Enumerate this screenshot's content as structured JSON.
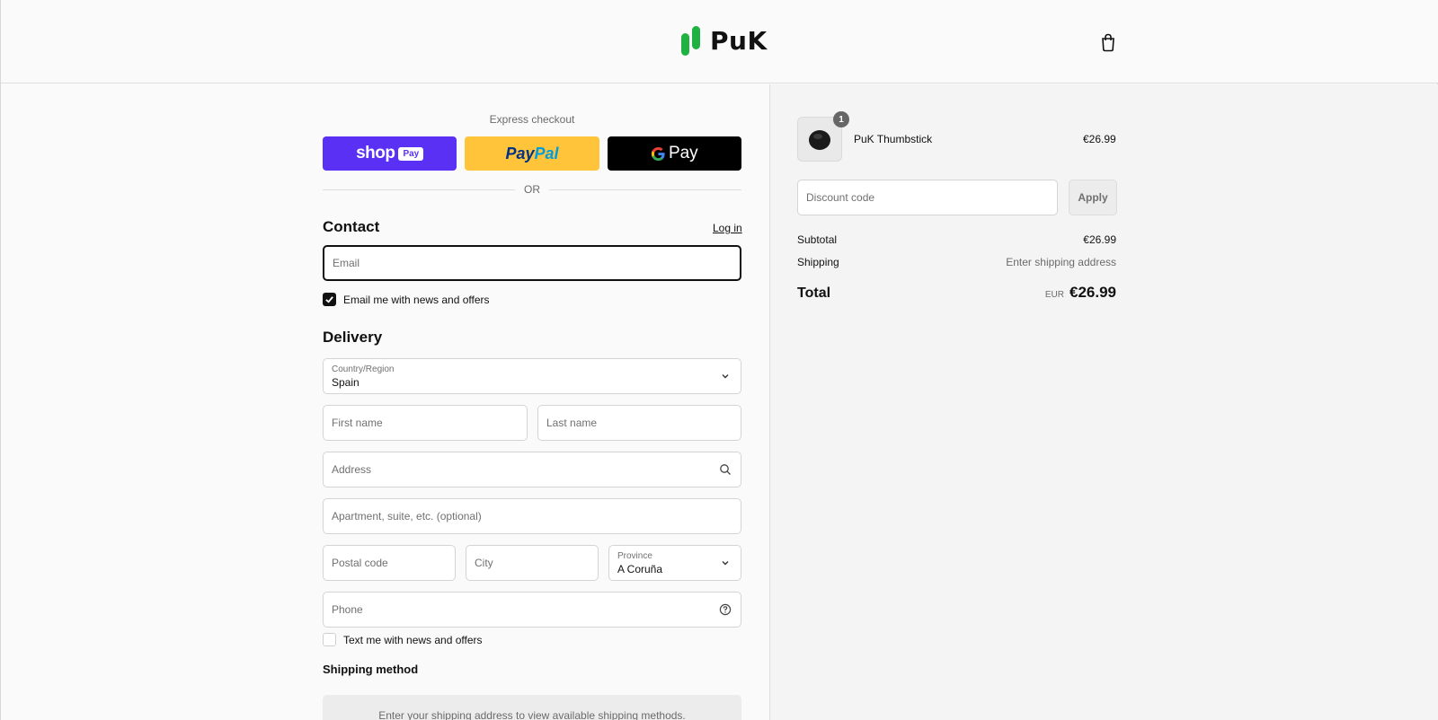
{
  "header": {
    "brand": "PuK",
    "cart_icon": "shopping-bag-icon"
  },
  "express": {
    "title": "Express checkout",
    "shop_pay": {
      "label": "shop",
      "badge": "Pay"
    },
    "paypal": {
      "part1": "Pay",
      "part2": "Pal"
    },
    "gpay": {
      "g": "G",
      "label": "Pay"
    },
    "or_label": "OR"
  },
  "contact": {
    "title": "Contact",
    "login_label": "Log in",
    "email_placeholder": "Email",
    "newsletter_label": "Email me with news and offers",
    "newsletter_checked": true
  },
  "delivery": {
    "title": "Delivery",
    "country_label": "Country/Region",
    "country_value": "Spain",
    "first_name_placeholder": "First name",
    "last_name_placeholder": "Last name",
    "address_placeholder": "Address",
    "apartment_placeholder": "Apartment, suite, etc. (optional)",
    "postal_placeholder": "Postal code",
    "city_placeholder": "City",
    "province_label": "Province",
    "province_value": "A Coruña",
    "phone_placeholder": "Phone",
    "sms_label": "Text me with news and offers",
    "sms_checked": false
  },
  "shipping_method": {
    "title": "Shipping method",
    "message": "Enter your shipping address to view available shipping methods."
  },
  "summary": {
    "product_name": "PuK Thumbstick",
    "product_price": "€26.99",
    "quantity": "1",
    "discount_placeholder": "Discount code",
    "apply_label": "Apply",
    "subtotal_label": "Subtotal",
    "subtotal_value": "€26.99",
    "shipping_label": "Shipping",
    "shipping_value": "Enter shipping address",
    "total_label": "Total",
    "total_currency": "EUR",
    "total_value": "€26.99"
  },
  "colors": {
    "brand_green": "#1fb141",
    "shop_pay": "#5a31f4",
    "paypal": "#ffc439"
  }
}
